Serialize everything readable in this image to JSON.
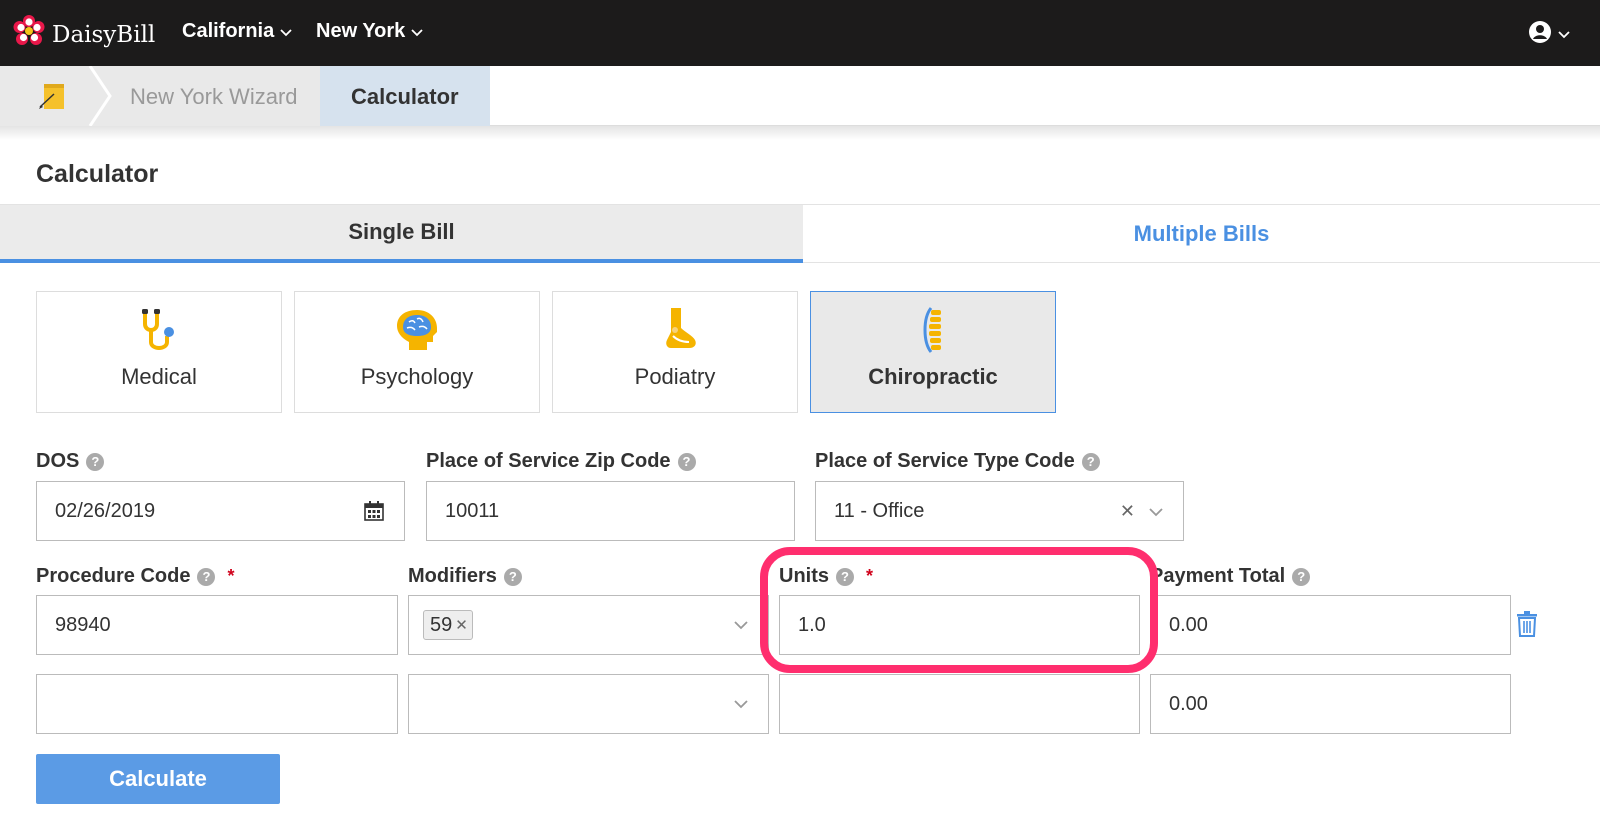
{
  "navbar": {
    "brand": "DaisyBill",
    "menus": [
      {
        "label": "California"
      },
      {
        "label": "New York"
      }
    ]
  },
  "breadcrumb": {
    "items": [
      "New York Wizard",
      "Calculator"
    ]
  },
  "page": {
    "title": "Calculator"
  },
  "tabs": [
    {
      "label": "Single Bill",
      "active": true
    },
    {
      "label": "Multiple Bills",
      "active": false
    }
  ],
  "specialties": [
    {
      "label": "Medical",
      "icon": "stethoscope-icon"
    },
    {
      "label": "Psychology",
      "icon": "brain-icon"
    },
    {
      "label": "Podiatry",
      "icon": "foot-icon"
    },
    {
      "label": "Chiropractic",
      "icon": "spine-icon",
      "selected": true
    }
  ],
  "form": {
    "dos": {
      "label": "DOS",
      "value": "02/26/2019"
    },
    "zip": {
      "label": "Place of Service Zip Code",
      "value": "10011"
    },
    "pos_type": {
      "label": "Place of Service Type Code",
      "value": "11 - Office"
    },
    "procedure": {
      "label": "Procedure Code",
      "required_mark": "*"
    },
    "modifiers": {
      "label": "Modifiers"
    },
    "units": {
      "label": "Units",
      "required_mark": "*"
    },
    "payment_total": {
      "label": "Payment Total"
    },
    "rows": [
      {
        "procedure": "98940",
        "modifier_chip": "59",
        "units": "1.0",
        "payment": "0.00"
      },
      {
        "procedure": "",
        "modifier_chip": "",
        "units": "",
        "payment": "0.00"
      }
    ]
  },
  "calculate_label": "Calculate",
  "colors": {
    "accent": "#4a90e2",
    "highlight": "#ff2e6e",
    "navbar": "#1c1b1b",
    "button": "#5b9be5"
  }
}
